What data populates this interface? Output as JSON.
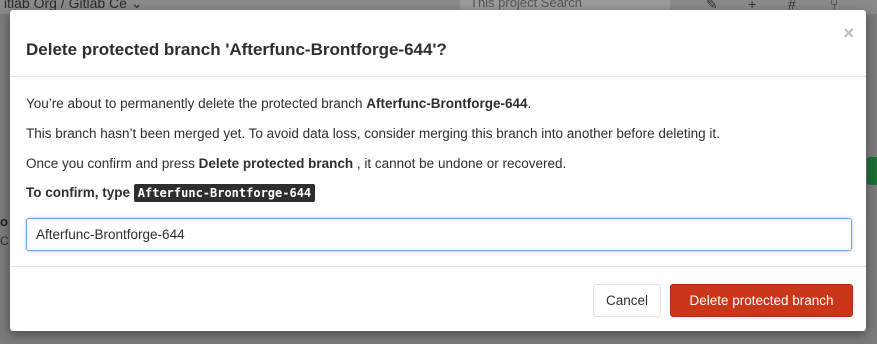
{
  "background": {
    "breadcrumb": "itlab Org / Gitlab Ce ⌄",
    "search_placeholder": "This project  Search",
    "side_text_1": "o",
    "side_text_2": "C"
  },
  "modal": {
    "title": "Delete protected branch 'Afterfunc-Brontforge-644'?",
    "close_label": "×",
    "line1_prefix": "You’re about to permanently delete the protected branch ",
    "line1_branch": "Afterfunc-Brontforge-644",
    "line1_suffix": ".",
    "line2": "This branch hasn’t been merged yet. To avoid data loss, consider merging this branch into another before deleting it.",
    "line3_prefix": "Once you confirm and press ",
    "line3_action": "Delete protected branch",
    "line3_suffix": " , it cannot be undone or recovered.",
    "confirm_label": "To confirm, type ",
    "confirm_code": "Afterfunc-Brontforge-644",
    "input_value": "Afterfunc-Brontforge-644",
    "cancel_label": "Cancel",
    "delete_label": "Delete protected branch"
  },
  "colors": {
    "danger": "#c9361a",
    "input_focus_border": "#6ea6de",
    "code_bg": "#2e2e2e"
  }
}
